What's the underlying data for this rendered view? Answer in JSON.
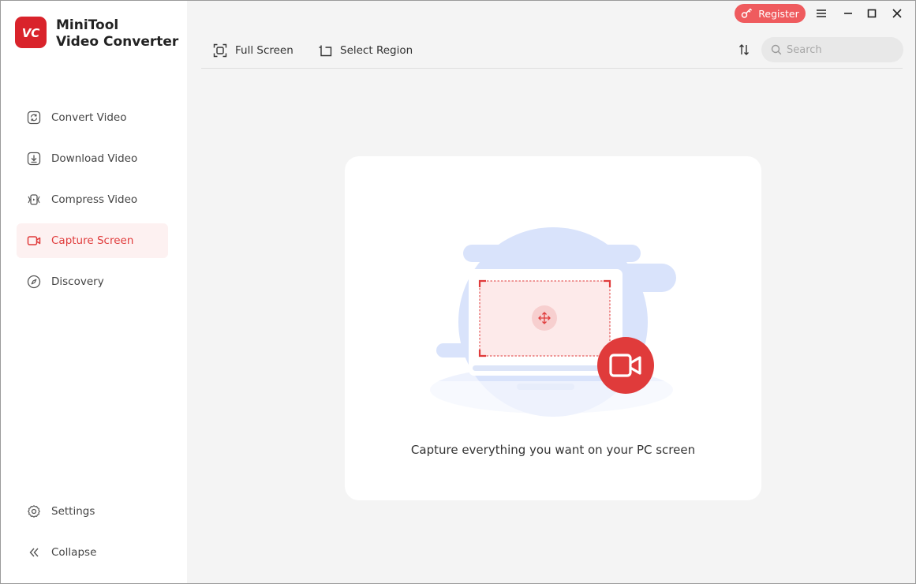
{
  "app": {
    "name_line1": "MiniTool",
    "name_line2": "Video Converter",
    "logo_text": "VC",
    "brand_color": "#d9232b",
    "accent_color": "#e03b3b"
  },
  "sidebar": {
    "items": [
      {
        "label": "Convert Video",
        "icon": "convert-icon",
        "active": false
      },
      {
        "label": "Download Video",
        "icon": "download-icon",
        "active": false
      },
      {
        "label": "Compress Video",
        "icon": "compress-icon",
        "active": false
      },
      {
        "label": "Capture Screen",
        "icon": "video-camera-icon",
        "active": true
      },
      {
        "label": "Discovery",
        "icon": "compass-icon",
        "active": false
      }
    ],
    "bottom": [
      {
        "label": "Settings",
        "icon": "gear-icon"
      },
      {
        "label": "Collapse",
        "icon": "double-chevron-left-icon"
      }
    ]
  },
  "titlebar": {
    "register_label": "Register",
    "register_icon": "key-icon",
    "buttons": [
      "menu-icon",
      "minimize-icon",
      "maximize-icon",
      "close-icon"
    ]
  },
  "toolbar": {
    "full_screen_label": "Full Screen",
    "select_region_label": "Select Region",
    "sort_icon": "sort-icon",
    "search_placeholder": "Search"
  },
  "main": {
    "caption": "Capture everything you want on your PC screen"
  }
}
